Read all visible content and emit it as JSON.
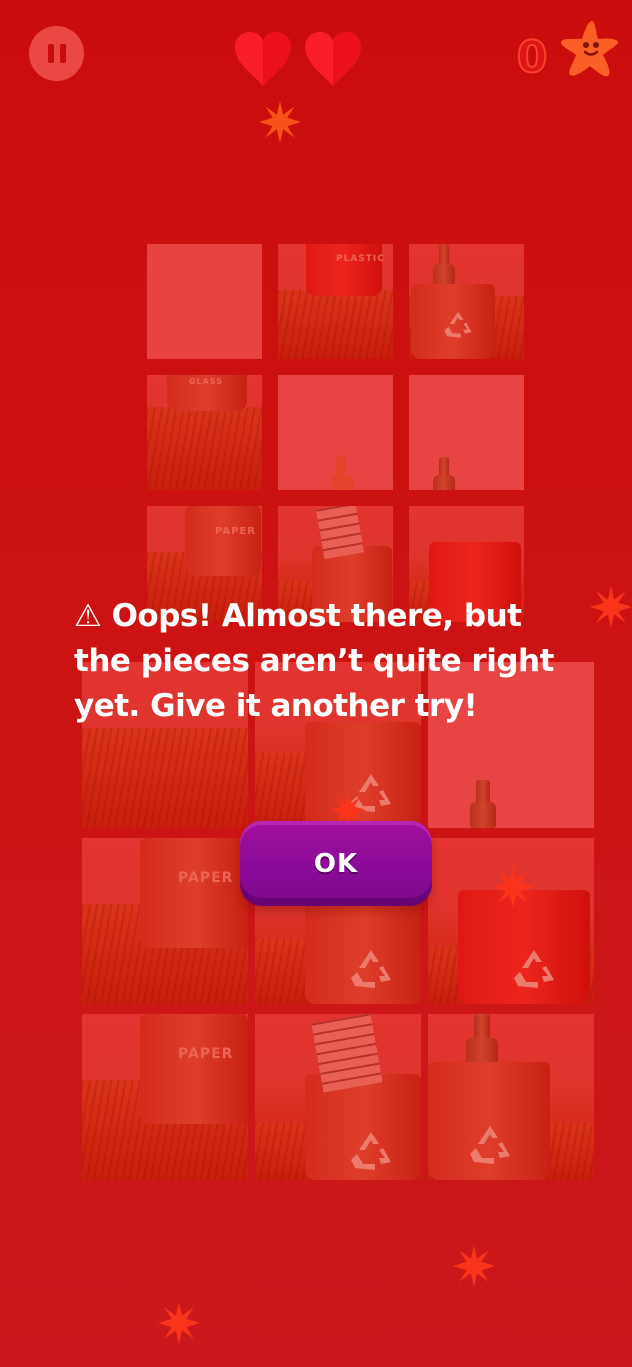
{
  "hud": {
    "lives": 2,
    "score": "0",
    "pause_icon": "pause-icon",
    "heart_icon": "heart-icon",
    "star_icon": "starfish-icon",
    "heart_color": "#ff1f2e",
    "score_color": "#e0161a"
  },
  "puzzle": {
    "reference_labels": {
      "plastic": "PLASTIC",
      "glass": "GLASS",
      "paper": "PAPER"
    },
    "board_labels": [
      "PAPER",
      "PAPER"
    ]
  },
  "dialog": {
    "message": "⚠ Oops! Almost there, but the pieces aren’t quite right yet. Give it another try!",
    "ok_label": "OK",
    "ok_color": "#9a0e9c"
  },
  "theme": {
    "background": "#cc1414",
    "accent": "#ff3a1c"
  }
}
